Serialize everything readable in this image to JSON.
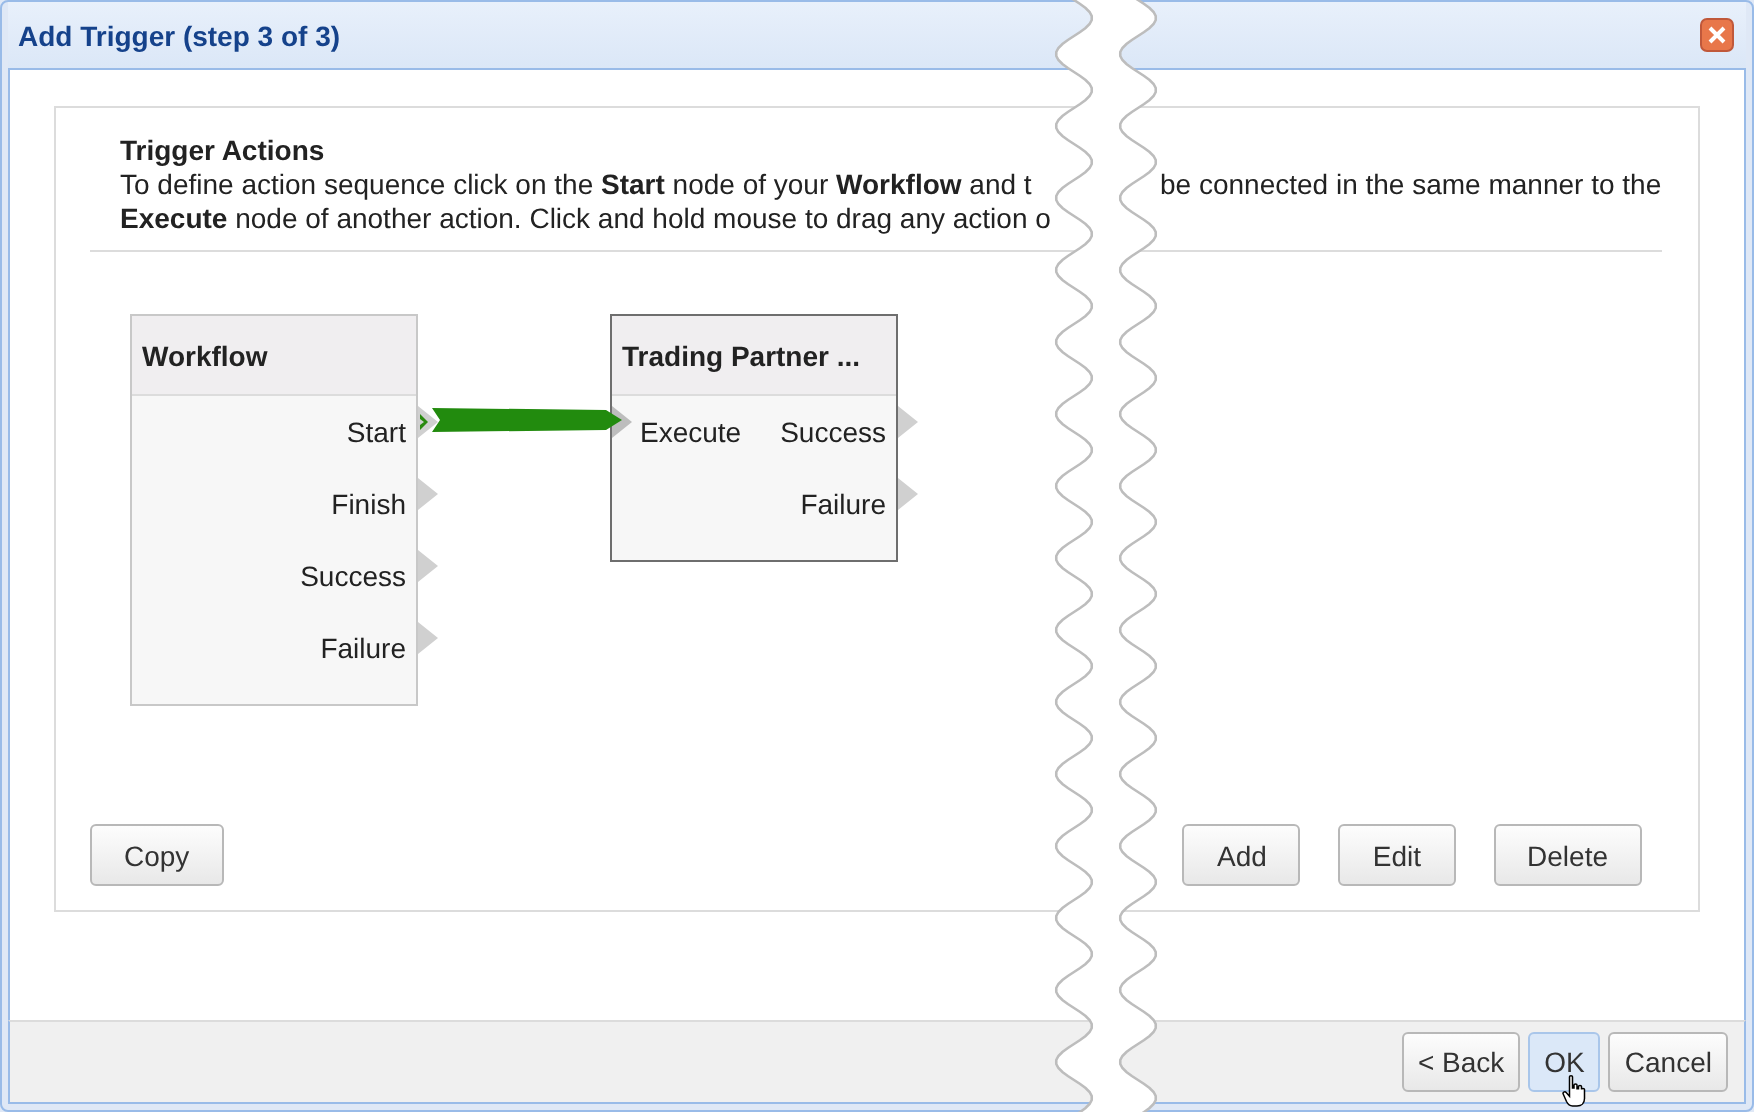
{
  "window": {
    "title": "Add Trigger (step 3 of 3)"
  },
  "section": {
    "title": "Trigger Actions",
    "description_left": [
      "To define action sequence click on the **Start** node of your **Workflow** and t",
      "**Execute** node of another action. Click and hold mouse to drag any action o"
    ],
    "description_right": [
      "be connected in the same manner to the"
    ]
  },
  "nodes": [
    {
      "title": "Workflow",
      "outputs": [
        {
          "label": "Start",
          "connected": true
        },
        {
          "label": "Finish",
          "connected": false
        },
        {
          "label": "Success",
          "connected": false
        },
        {
          "label": "Failure",
          "connected": false
        }
      ]
    },
    {
      "title": "Trading Partner ...",
      "inputs": [
        {
          "label": "Execute",
          "connected": true
        }
      ],
      "outputs": [
        {
          "label": "Success",
          "connected": false
        },
        {
          "label": "Failure",
          "connected": false
        }
      ]
    }
  ],
  "panel_buttons_left": [
    "Copy"
  ],
  "panel_buttons_right": [
    "Add",
    "Edit",
    "Delete"
  ],
  "footer_buttons": [
    {
      "label": "< Back",
      "hovered": false
    },
    {
      "label": "OK",
      "hovered": true
    },
    {
      "label": "Cancel",
      "hovered": false
    }
  ]
}
